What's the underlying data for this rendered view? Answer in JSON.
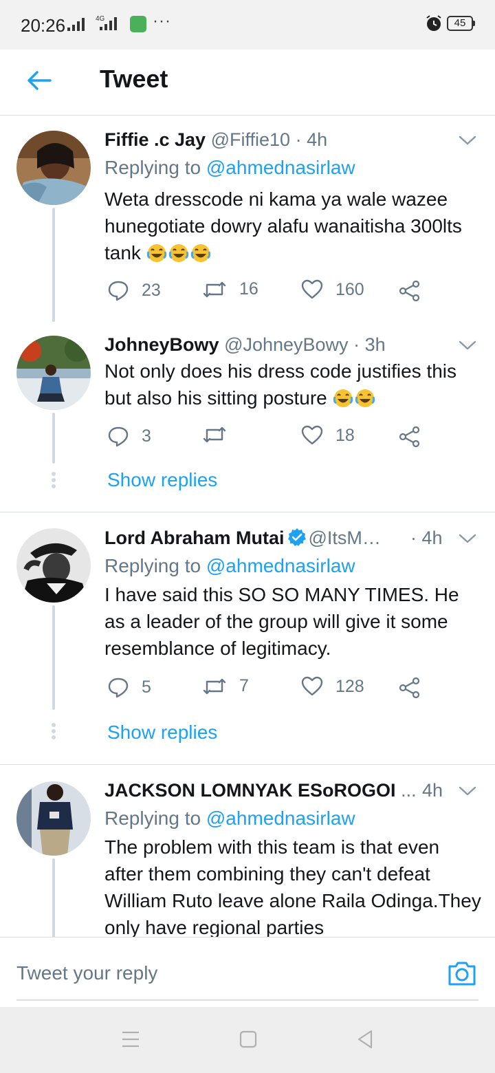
{
  "status_bar": {
    "time": "20:26",
    "network": "4G",
    "battery": "45",
    "more": "···"
  },
  "header": {
    "title": "Tweet"
  },
  "tweets": [
    {
      "name": "Fiffie .c Jay",
      "handle": "@Fiffie10",
      "time": "· 4h",
      "replying_prefix": "Replying to ",
      "replying_handle": "@ahmednasirlaw",
      "text": "Weta dresscode ni kama ya wale wazee hunegotiate dowry alafu wanaitisha 300lts tank",
      "emoji_count": 3,
      "replies": "23",
      "retweets": "16",
      "likes": "160"
    },
    {
      "name": "JohneyBowy",
      "handle": "@JohneyBowy",
      "time": "· 3h",
      "text": "Not only does his dress code justifies this but also his sitting posture",
      "emoji_count": 2,
      "replies": "3",
      "retweets": "",
      "likes": "18",
      "show_replies": "Show replies"
    },
    {
      "name": "Lord Abraham Mutai",
      "verified": true,
      "handle": "@ItsM…",
      "time": "· 4h",
      "replying_prefix": "Replying to ",
      "replying_handle": "@ahmednasirlaw",
      "text": "I have said this SO SO MANY TIMES. He as a leader of the group will give it some resemblance of legitimacy.",
      "replies": "5",
      "retweets": "7",
      "likes": "128",
      "show_replies": "Show replies"
    },
    {
      "name": "JACKSON LOMNYAK ESoROGOI",
      "handle": "...",
      "time": "4h",
      "replying_prefix": "Replying to ",
      "replying_handle": "@ahmednasirlaw",
      "text": "The problem with this team is that even after them combining they can't defeat William Ruto leave alone Raila Odinga.They only have regional parties"
    }
  ],
  "reply_bar": {
    "placeholder": "Tweet your reply"
  },
  "colors": {
    "accent": "#1da1f2",
    "secondary_text": "#657786",
    "divider": "#d8dee2"
  },
  "icons": [
    "back-arrow-icon",
    "chevron-down-icon",
    "reply-icon",
    "retweet-icon",
    "like-icon",
    "share-icon",
    "verified-icon",
    "camera-icon",
    "menu-icon",
    "home-icon",
    "back-icon"
  ]
}
